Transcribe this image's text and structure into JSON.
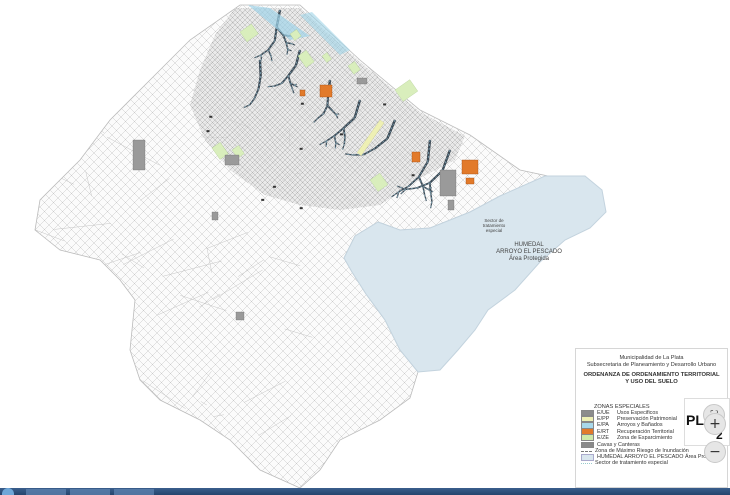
{
  "map": {
    "labels": {
      "wetland_title": "HUMEDAL\nARROYO EL PESCADO\nÁrea Protegida",
      "special_sector": "Sector de\ntratamiento\nespecial"
    },
    "colors": {
      "streets": "#c4c4c4",
      "urban_block": "#dcdcdc",
      "green_space": "#d9eebc",
      "streams": "#9fd3e8",
      "recovery": "#e27a2a",
      "special_use": "#9a9a9a",
      "protected_area": "#d9e6ee",
      "heritage": "#eef0b4"
    }
  },
  "legend": {
    "municipality": "Municipalidad de La Plata",
    "secretariat": "Subsecretaria de Planeamiento y Desarrollo Urbano",
    "ordinance_line1": "ORDENANZA DE ORDENAMIENTO TERRITORIAL",
    "ordinance_line2": "Y  USO DEL SUELO",
    "section_title": "ZONAS ESPECIALES",
    "zones": [
      {
        "code": "E/UE",
        "label": "Usos Especificos",
        "color": "#8c8c8c"
      },
      {
        "code": "E/PP",
        "label": "Preservación Patrimonial",
        "color": "#eef0b4"
      },
      {
        "code": "E/PA",
        "label": "Arroyos y Bañados",
        "color": "#a8d8ea"
      },
      {
        "code": "E/RT",
        "label": "Recuperación Territorial",
        "color": "#e27a2a"
      },
      {
        "code": "E/ZE",
        "label": "Zona de Esparcimiento",
        "color": "#cfe9a8"
      }
    ],
    "extras": {
      "quarries": "Cavas y Canteras",
      "flood_zone": "Zona de Máximo Riesgo de Inundación",
      "protected": "HUMEDAL ARROYO EL PESCADO Área Protegida",
      "special_treatment": "Sector de tratamiento especial"
    },
    "quarries_color": "#8a8a8a"
  },
  "plan": {
    "label": "PLA",
    "number": "2"
  },
  "controls": {
    "zoom_in": "+",
    "zoom_out": "−",
    "fullscreen_icon": "fullscreen-icon"
  }
}
